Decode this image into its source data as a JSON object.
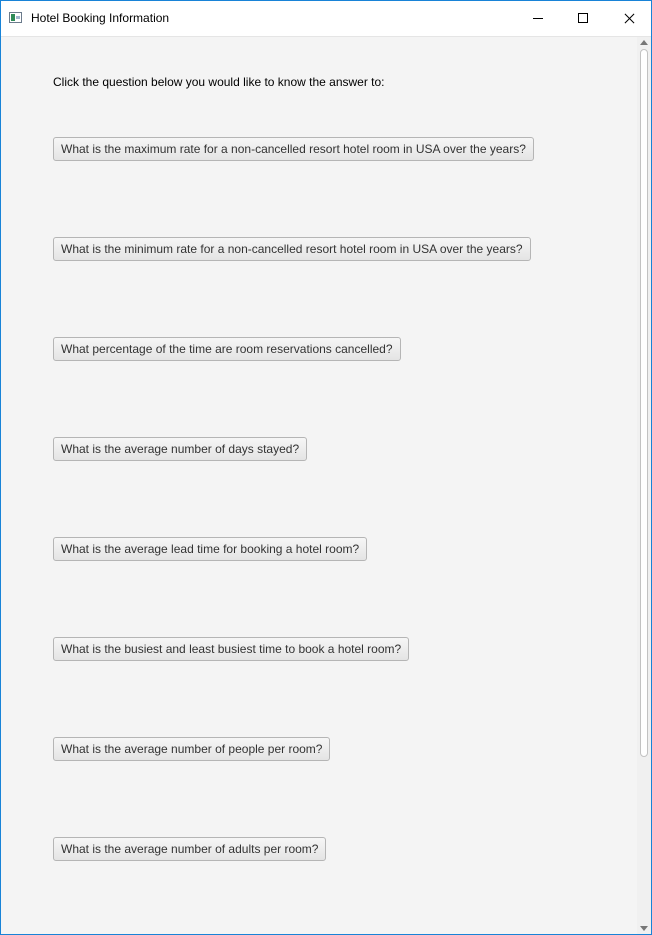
{
  "window": {
    "title": "Hotel Booking Information",
    "icon": "app-window-icon"
  },
  "prompt": "Click the question below you would like to know the answer to:",
  "questions": [
    "What is the maximum rate for a non-cancelled resort hotel room in USA over the years?",
    "What is the minimum rate for a non-cancelled resort hotel room in USA over the years?",
    "What percentage of the time are room reservations cancelled?",
    "What is the average number of days stayed?",
    "What is the average lead time for booking a hotel room?",
    "What is the busiest and least busiest time to book a hotel room?",
    "What is the average number of people per room?",
    "What is the average number of adults per room?"
  ],
  "colors": {
    "window_border": "#1883d7",
    "content_background": "#f4f4f4"
  }
}
